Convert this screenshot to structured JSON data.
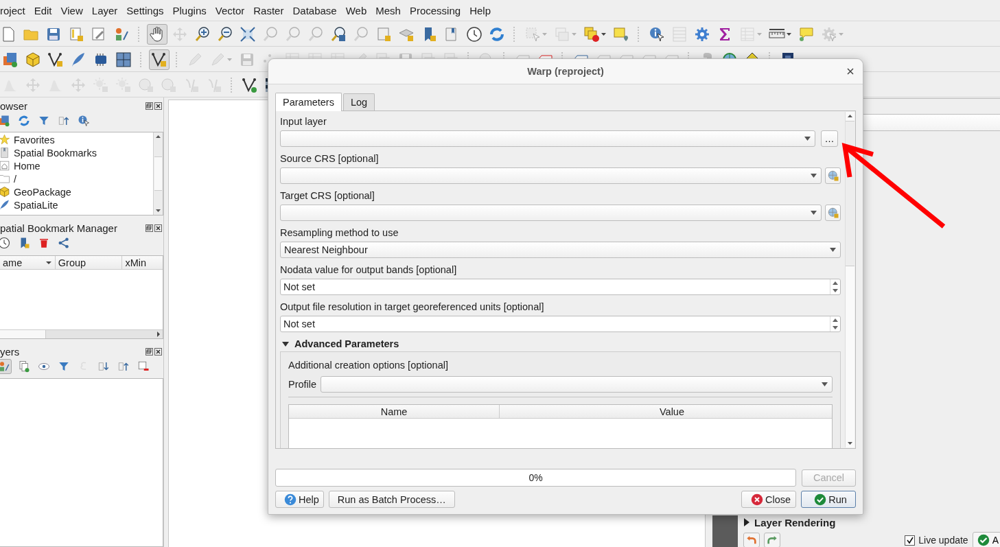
{
  "menu_bar": [
    "roject",
    "Edit",
    "View",
    "Layer",
    "Settings",
    "Plugins",
    "Vector",
    "Raster",
    "Database",
    "Web",
    "Mesh",
    "Processing",
    "Help"
  ],
  "toolbars": [
    {
      "buttons": [
        {
          "disabled": false,
          "active": false
        },
        {
          "disabled": false,
          "active": false
        },
        {
          "disabled": false,
          "active": false
        },
        {
          "disabled": false,
          "active": false
        },
        {
          "disabled": false,
          "active": false
        },
        {
          "disabled": false,
          "active": false
        },
        {
          "disabled": false,
          "active": true
        },
        {
          "disabled": true,
          "active": false
        },
        {
          "disabled": false,
          "active": false
        },
        {
          "disabled": false,
          "active": false
        },
        {
          "disabled": false,
          "active": false
        },
        {
          "disabled": true,
          "active": false
        },
        {
          "disabled": true,
          "active": false
        },
        {
          "disabled": true,
          "active": false
        },
        {
          "disabled": false,
          "active": false
        },
        {
          "disabled": true,
          "active": false
        },
        {
          "disabled": false,
          "active": false
        },
        {
          "disabled": false,
          "active": false
        },
        {
          "disabled": false,
          "active": false
        },
        {
          "disabled": false,
          "active": false
        },
        {
          "disabled": false,
          "active": false
        },
        {
          "disabled": false,
          "active": false
        },
        {
          "disabled": true,
          "active": false
        },
        {
          "disabled": true,
          "active": false
        },
        {
          "disabled": false,
          "active": false
        },
        {
          "disabled": false,
          "active": false
        },
        {
          "disabled": false,
          "active": false
        },
        {
          "disabled": true,
          "active": false
        },
        {
          "disabled": false,
          "active": false
        },
        {
          "disabled": false,
          "active": false
        },
        {
          "disabled": true,
          "active": false
        },
        {
          "disabled": false,
          "active": false
        },
        {
          "disabled": false,
          "active": false
        },
        {
          "disabled": true,
          "active": false
        }
      ]
    },
    {
      "buttons": [
        {
          "disabled": false,
          "active": false
        },
        {
          "disabled": false,
          "active": false
        },
        {
          "disabled": false,
          "active": false
        },
        {
          "disabled": false,
          "active": false
        },
        {
          "disabled": false,
          "active": false
        },
        {
          "disabled": false,
          "active": false
        },
        {
          "disabled": false,
          "active": true
        },
        {
          "disabled": true,
          "active": false
        },
        {
          "disabled": true,
          "active": false
        },
        {
          "disabled": true,
          "active": false
        },
        {
          "disabled": true,
          "active": false
        },
        {
          "disabled": true,
          "active": false
        },
        {
          "disabled": true,
          "active": false
        },
        {
          "disabled": true,
          "active": false
        },
        {
          "disabled": true,
          "active": false
        },
        {
          "disabled": true,
          "active": false
        },
        {
          "disabled": true,
          "active": false
        },
        {
          "disabled": true,
          "active": false
        },
        {
          "disabled": true,
          "active": false
        },
        {
          "disabled": true,
          "active": false
        },
        {
          "disabled": true,
          "active": false
        },
        {
          "disabled": false,
          "active": false
        },
        {
          "disabled": false,
          "active": false
        },
        {
          "disabled": true,
          "active": false
        },
        {
          "disabled": true,
          "active": false
        },
        {
          "disabled": true,
          "active": false
        },
        {
          "disabled": true,
          "active": false
        },
        {
          "disabled": true,
          "active": false
        },
        {
          "disabled": false,
          "active": false
        },
        {
          "disabled": false,
          "active": false
        },
        {
          "disabled": false,
          "active": false
        }
      ]
    },
    {
      "buttons": [
        {
          "disabled": true,
          "active": false
        },
        {
          "disabled": true,
          "active": false
        },
        {
          "disabled": true,
          "active": false
        },
        {
          "disabled": true,
          "active": false
        },
        {
          "disabled": true,
          "active": false
        },
        {
          "disabled": true,
          "active": false
        },
        {
          "disabled": true,
          "active": false
        },
        {
          "disabled": true,
          "active": false
        },
        {
          "disabled": true,
          "active": false
        },
        {
          "disabled": true,
          "active": false
        },
        {
          "disabled": false,
          "active": false
        },
        {
          "disabled": false,
          "active": false
        }
      ]
    }
  ],
  "browser_panel": {
    "title": "owser",
    "items": [
      {
        "label": "Favorites"
      },
      {
        "label": "Spatial Bookmarks"
      },
      {
        "label": "Home"
      },
      {
        "label": "/"
      },
      {
        "label": "GeoPackage"
      },
      {
        "label": "SpatiaLite"
      }
    ]
  },
  "bookmark_panel": {
    "title": "patial Bookmark Manager",
    "columns": [
      "ame",
      "Group",
      "xMin"
    ]
  },
  "layers_panel": {
    "title": "yers"
  },
  "style_panel": {
    "section": {
      "label": "Layer Rendering",
      "expanded": false
    },
    "live_update": {
      "label": "Live update",
      "checked": true
    },
    "apply_button": "A"
  },
  "dialog": {
    "title": "Warp (reproject)",
    "tabs": [
      {
        "label": "Parameters",
        "selected": true
      },
      {
        "label": "Log",
        "selected": false
      }
    ],
    "parameters": [
      {
        "kind": "layer",
        "label": "Input layer"
      },
      {
        "kind": "crs",
        "label": "Source CRS [optional]"
      },
      {
        "kind": "crs",
        "label": "Target CRS [optional]"
      },
      {
        "kind": "combo",
        "label": "Resampling method to use",
        "value": "Nearest Neighbour"
      },
      {
        "kind": "spin",
        "label": "Nodata value for output bands [optional]",
        "value": "Not set"
      },
      {
        "kind": "spin",
        "label": "Output file resolution in target georeferenced units [optional]",
        "value": "Not set"
      }
    ],
    "browse_button": "…",
    "advanced": {
      "label": "Advanced Parameters",
      "expanded": true,
      "group_label": "Additional creation options [optional]",
      "profile_label": "Profile",
      "columns": [
        "Name",
        "Value"
      ]
    },
    "progress": {
      "level": 0,
      "text": "0%"
    },
    "cancel": {
      "label": "Cancel",
      "disabled": true
    },
    "buttons": [
      {
        "kind": "help",
        "label": "Help",
        "default": false
      },
      {
        "kind": "plain",
        "label": "Run as Batch Process…",
        "default": false
      },
      {
        "kind": "close",
        "label": "Close",
        "default": false
      },
      {
        "kind": "run",
        "label": "Run",
        "default": true
      }
    ]
  }
}
